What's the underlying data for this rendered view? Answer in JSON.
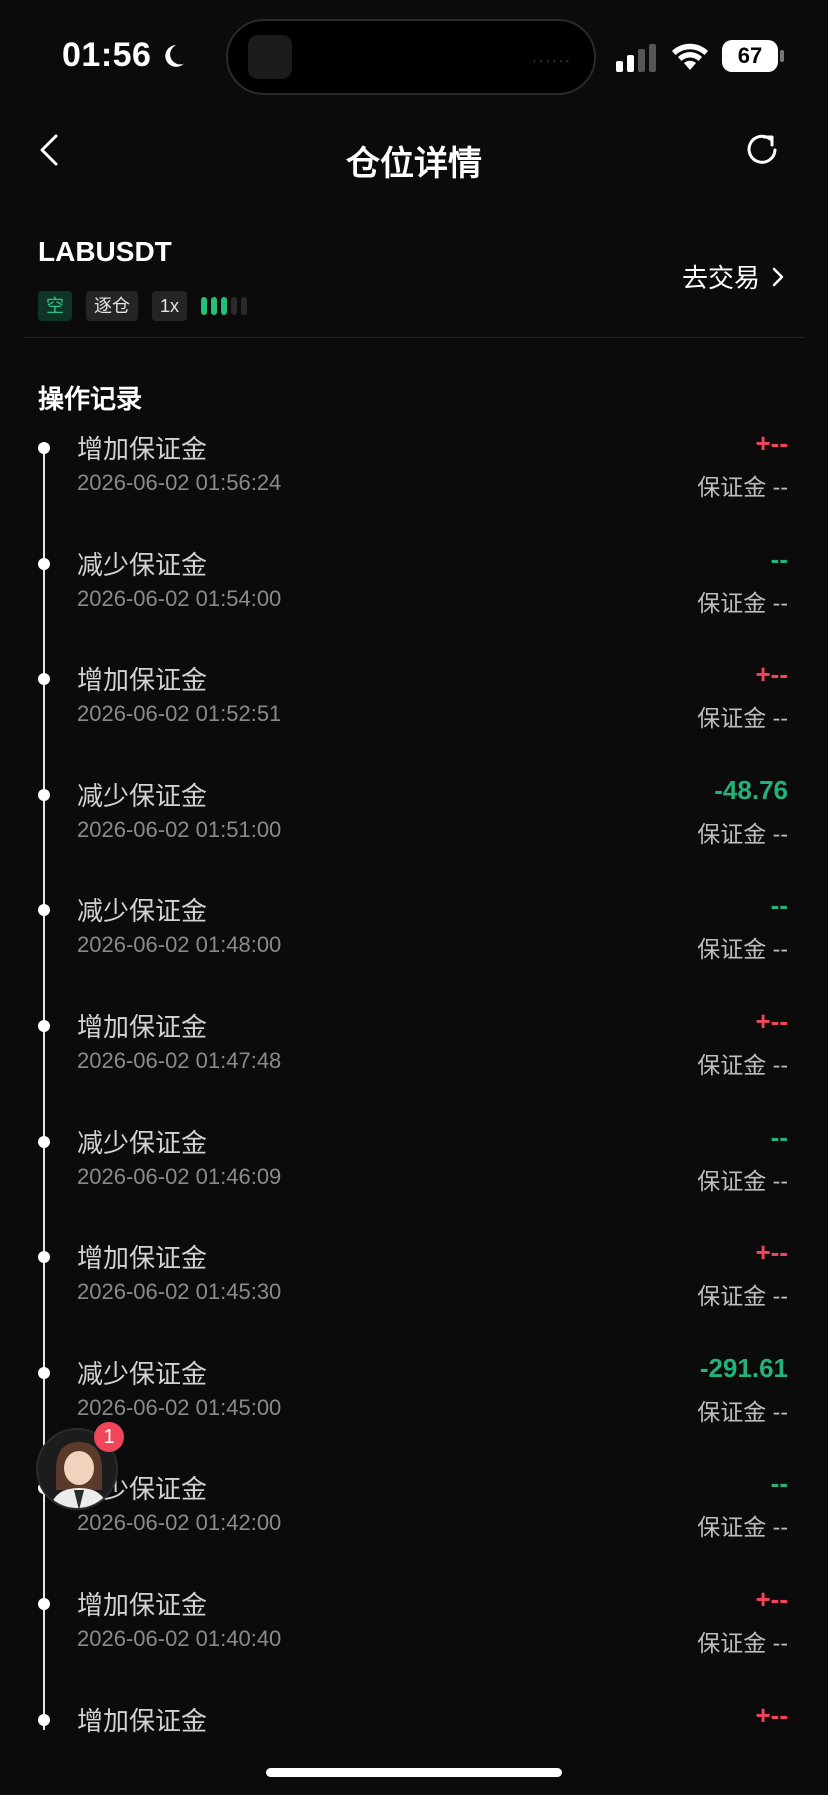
{
  "status_bar": {
    "time": "01:56",
    "battery": "67"
  },
  "nav": {
    "title": "仓位详情"
  },
  "position": {
    "symbol": "LABUSDT",
    "side_tag": "空",
    "margin_mode_tag": "逐仓",
    "leverage_tag": "1x",
    "trade_link": "去交易"
  },
  "colors": {
    "increase": "#f2455b",
    "decrease": "#23b27a",
    "accent_short": "#2fbf8a"
  },
  "records": {
    "title": "操作记录",
    "items": [
      {
        "action": "增加保证金",
        "time": "2026-06-02 01:56:24",
        "amount": "+--",
        "direction": "pos",
        "margin": "保证金 --"
      },
      {
        "action": "减少保证金",
        "time": "2026-06-02 01:54:00",
        "amount": "--",
        "direction": "neg",
        "margin": "保证金 --"
      },
      {
        "action": "增加保证金",
        "time": "2026-06-02 01:52:51",
        "amount": "+--",
        "direction": "pos",
        "margin": "保证金 --"
      },
      {
        "action": "减少保证金",
        "time": "2026-06-02 01:51:00",
        "amount": "-48.76",
        "direction": "neg",
        "margin": "保证金 --"
      },
      {
        "action": "减少保证金",
        "time": "2026-06-02 01:48:00",
        "amount": "--",
        "direction": "neg",
        "margin": "保证金 --"
      },
      {
        "action": "增加保证金",
        "time": "2026-06-02 01:47:48",
        "amount": "+--",
        "direction": "pos",
        "margin": "保证金 --"
      },
      {
        "action": "减少保证金",
        "time": "2026-06-02 01:46:09",
        "amount": "--",
        "direction": "neg",
        "margin": "保证金 --"
      },
      {
        "action": "增加保证金",
        "time": "2026-06-02 01:45:30",
        "amount": "+--",
        "direction": "pos",
        "margin": "保证金 --"
      },
      {
        "action": "减少保证金",
        "time": "2026-06-02 01:45:00",
        "amount": "-291.61",
        "direction": "neg",
        "margin": "保证金 --"
      },
      {
        "action": "减少保证金",
        "time": "2026-06-02 01:42:00",
        "amount": "--",
        "direction": "neg",
        "margin": "保证金 --"
      },
      {
        "action": "增加保证金",
        "time": "2026-06-02 01:40:40",
        "amount": "+--",
        "direction": "pos",
        "margin": "保证金 --"
      },
      {
        "action": "增加保证金",
        "time": "",
        "amount": "+--",
        "direction": "pos",
        "margin": ""
      }
    ]
  },
  "support_avatar": {
    "badge_count": "1"
  }
}
